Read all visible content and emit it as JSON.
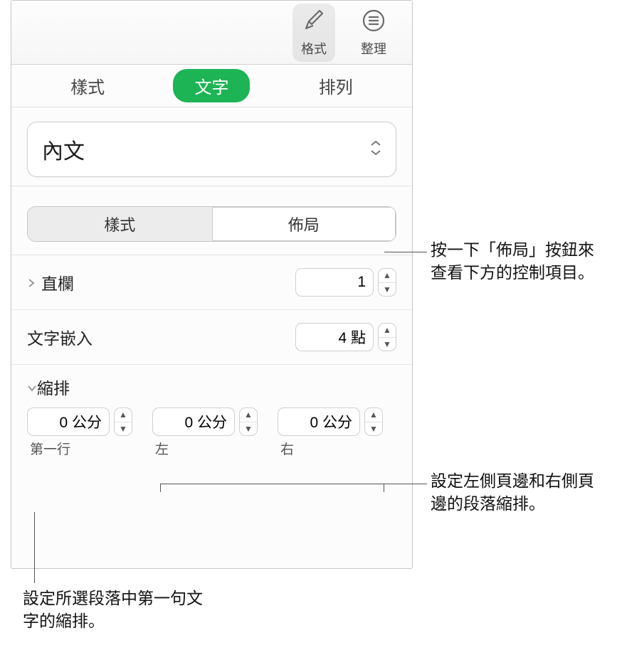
{
  "toolbar": {
    "format_label": "格式",
    "arrange_label": "整理"
  },
  "subtabs": {
    "style": "樣式",
    "text": "文字",
    "arrange": "排列"
  },
  "para_style": {
    "selected": "內文"
  },
  "segmented": {
    "style": "樣式",
    "layout": "佈局"
  },
  "rows": {
    "columns_label": "直欄",
    "columns_value": "1",
    "text_inset_label": "文字嵌入",
    "text_inset_value": "4 點"
  },
  "indent": {
    "header": "縮排",
    "first_value": "0 公分",
    "first_label": "第一行",
    "left_value": "0 公分",
    "left_label": "左",
    "right_value": "0 公分",
    "right_label": "右"
  },
  "callouts": {
    "layout": "按一下「佈局」按鈕來查看下方的控制項目。",
    "margins": "設定左側頁邊和右側頁邊的段落縮排。",
    "first_line": "設定所選段落中第一句文字的縮排。"
  }
}
